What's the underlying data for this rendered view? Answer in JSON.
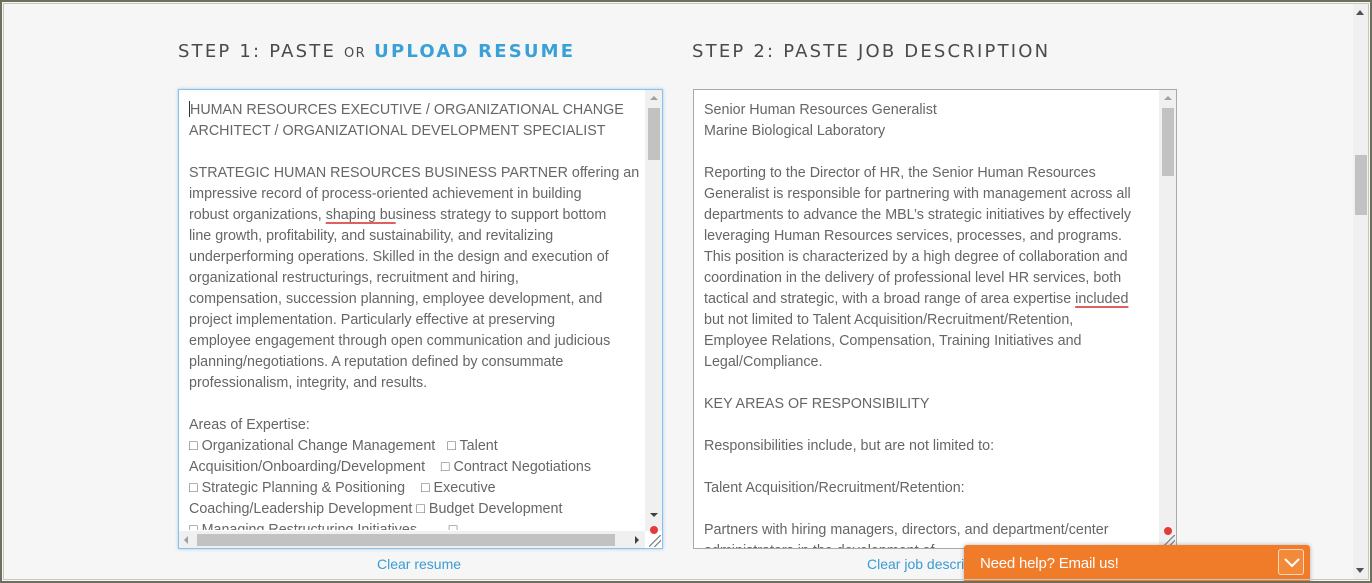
{
  "step1": {
    "prefix": "STEP 1: PASTE",
    "or": "OR",
    "upload_link": "UPLOAD RESUME"
  },
  "step2": {
    "title": "STEP 2: PASTE JOB DESCRIPTION"
  },
  "resume": {
    "line1_head": "HUMAN RESOURCES EXECUTIVE / ORGANIZATIONAL CHANGE\nARCHITECT / ORGANIZATIONAL DEVELOPMENT SPECIALIST\n\nSTRATEGIC HUMAN RESOURCES BUSINESS PARTNER offering an\nimpressive record of process-oriented achievement in building\nrobust organizations, ",
    "misspelled": "shaping bu",
    "body_rest": "siness strategy to support bottom\nline growth, profitability, and sustainability, and revitalizing\nunderperforming operations. Skilled in the design and execution of\norganizational restructurings, recruitment and hiring,\ncompensation, succession planning, employee development, and\nproject implementation. Particularly effective at preserving\nemployee engagement through open communication and judicious\nplanning/negotiations. A reputation defined by consummate\nprofessionalism, integrity, and results.\n\nAreas of Expertise:\n□ Organizational Change Management   □ Talent\nAcquisition/Onboarding/Development    □ Contract Negotiations\n□ Strategic Planning & Positioning    □ Executive\nCoaching/Leadership Development □ Budget Development\n□ Managing Restructuring Initiatives        □",
    "clear_label": "Clear resume"
  },
  "job": {
    "text_before": "Senior Human Resources Generalist\nMarine Biological Laboratory\n\nReporting to the Director of HR, the Senior Human Resources\nGeneralist is responsible for partnering with management across all\ndepartments to advance the MBL’s strategic initiatives by effectively\nleveraging Human Resources services, processes, and programs.\nThis position is characterized by a high degree of collaboration and\ncoordination in the delivery of professional level HR services, both\ntactical and strategic, with a broad range of area expertise ",
    "misspelled": "included",
    "text_after": "\nbut not limited to Talent Acquisition/Recruitment/Retention,\nEmployee Relations, Compensation, Training Initiatives and\nLegal/Compliance.\n\nKEY AREAS OF RESPONSIBILITY\n\nResponsibilities include, but are not limited to:\n\nTalent Acquisition/Recruitment/Retention:\n\nPartners with hiring managers, directors, and department/center\nadministrators in the development of",
    "clear_label": "Clear job description"
  },
  "help": {
    "label": "Need help? Email us!",
    "toggle_icon": "chevron-down-icon"
  },
  "colors": {
    "accent": "#3aa0d8",
    "help_bar": "#f07c2a",
    "spellcheck": "#e06060"
  }
}
